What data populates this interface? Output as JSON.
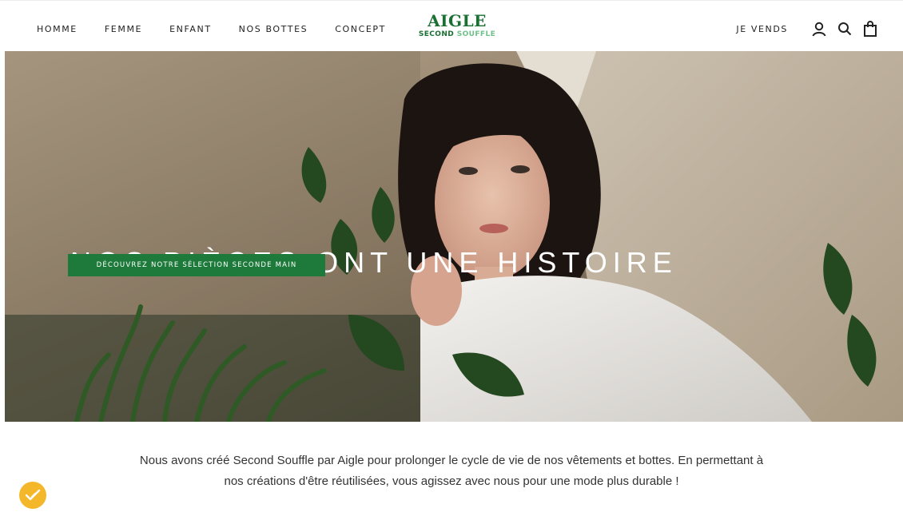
{
  "header": {
    "nav": [
      "HOMME",
      "FEMME",
      "ENFANT",
      "NOS BOTTES",
      "CONCEPT"
    ],
    "logo": {
      "brand": "AIGLE",
      "sub_primary": "SECOND",
      "sub_secondary": "SOUFFLE"
    },
    "sell_link": "JE VENDS",
    "icons": [
      "account-icon",
      "search-icon",
      "shopping-bag-icon"
    ]
  },
  "hero": {
    "title": "NOS PIÈCES ONT UNE HISTOIRE",
    "cta_label": "DÉCOUVREZ NOTRE SÉLECTION SECONDE MAIN"
  },
  "intro": {
    "text": "Nous avons créé Second Souffle par Aigle pour prolonger le cycle de vie de nos vêtements et bottes. En permettant à nos créations d'être réutilisées, vous agissez avec nous pour une mode plus durable !"
  },
  "badge": {
    "icon": "checkmark-badge-icon",
    "color": "#f5b72a"
  },
  "colors": {
    "brand_green": "#1b6f33",
    "cta_green": "#1d7a3a",
    "accent_light_green": "#6fc08a"
  }
}
